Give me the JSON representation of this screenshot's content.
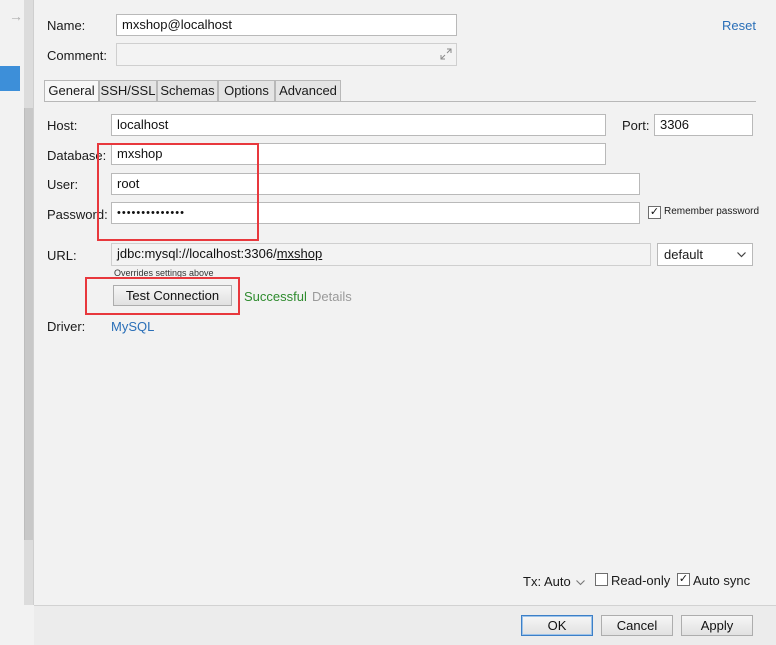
{
  "form": {
    "name_label": "Name:",
    "name_value": "mxshop@localhost",
    "reset_label": "Reset",
    "comment_label": "Comment:",
    "comment_value": ""
  },
  "tabs": [
    {
      "label": "General",
      "active": true
    },
    {
      "label": "SSH/SSL",
      "active": false
    },
    {
      "label": "Schemas",
      "active": false
    },
    {
      "label": "Options",
      "active": false
    },
    {
      "label": "Advanced",
      "active": false
    }
  ],
  "general": {
    "host_label": "Host:",
    "host_value": "localhost",
    "port_label": "Port:",
    "port_value": "3306",
    "database_label": "Database:",
    "database_value": "mxshop",
    "user_label": "User:",
    "user_value": "root",
    "password_label": "Password:",
    "password_value": "••••••••••••••",
    "remember_password_label": "Remember password",
    "remember_password_checked": true,
    "url_label": "URL:",
    "url_prefix": "jdbc:mysql://localhost:3306/",
    "url_db": "mxshop",
    "url_mode": "default",
    "overrides_note": "Overrides settings above",
    "test_connection_label": "Test Connection",
    "status_text": "Successful",
    "details_label": "Details",
    "driver_label": "Driver:",
    "driver_value": "MySQL"
  },
  "footer": {
    "tx_label": "Tx: Auto",
    "readonly_label": "Read-only",
    "readonly_checked": false,
    "autosync_label": "Auto sync",
    "autosync_checked": true,
    "ok_label": "OK",
    "cancel_label": "Cancel",
    "apply_label": "Apply"
  },
  "colors": {
    "link": "#2a6fb8",
    "success": "#2e8b2e",
    "highlight_box": "#e8383d",
    "selection": "#3d8fd9"
  }
}
